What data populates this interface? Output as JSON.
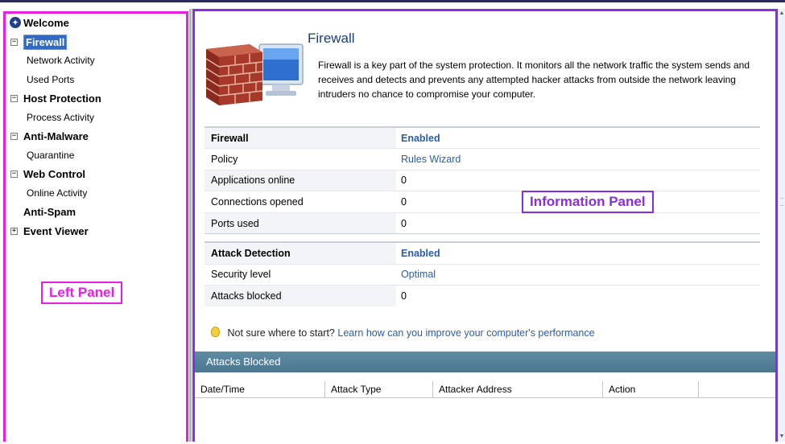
{
  "left_panel": {
    "annotation": "Left Panel",
    "tree": [
      {
        "label": "Welcome",
        "level": "top",
        "icon": "welcome-icon"
      },
      {
        "label": "Firewall",
        "level": "top",
        "expander": "⊟",
        "selected": true
      },
      {
        "label": "Network Activity",
        "level": "sub"
      },
      {
        "label": "Used Ports",
        "level": "sub"
      },
      {
        "label": "Host Protection",
        "level": "top",
        "expander": "⊟"
      },
      {
        "label": "Process Activity",
        "level": "sub"
      },
      {
        "label": "Anti-Malware",
        "level": "top",
        "expander": "⊟"
      },
      {
        "label": "Quarantine",
        "level": "sub"
      },
      {
        "label": "Web Control",
        "level": "top",
        "expander": "⊟"
      },
      {
        "label": "Online Activity",
        "level": "sub"
      },
      {
        "label": "Anti-Spam",
        "level": "top"
      },
      {
        "label": "Event Viewer",
        "level": "top",
        "expander": "⊞"
      }
    ]
  },
  "info_panel": {
    "annotation": "Information Panel",
    "title": "Firewall",
    "description": "Firewall is a key part of the system protection. It monitors all the network traffic the system sends and receives and detects and prevents any attempted hacker attacks from outside the network leaving intruders no chance to compromise your computer.",
    "firewall_rows": [
      {
        "label": "Firewall",
        "value": "Enabled",
        "link": true,
        "header": true
      },
      {
        "label": "Policy",
        "value": "Rules Wizard",
        "link": true
      },
      {
        "label": "Applications online",
        "value": "0"
      },
      {
        "label": "Connections opened",
        "value": "0"
      },
      {
        "label": "Ports used",
        "value": "0"
      }
    ],
    "attack_rows": [
      {
        "label": "Attack Detection",
        "value": "Enabled",
        "link": true,
        "header": true
      },
      {
        "label": "Security level",
        "value": "Optimal",
        "link": true
      },
      {
        "label": "Attacks blocked",
        "value": "0"
      }
    ],
    "tip": {
      "text": "Not sure where to start?",
      "link": "Learn how can you improve your computer's performance"
    },
    "attacks_blocked": {
      "title": "Attacks Blocked",
      "columns": [
        "Date/Time",
        "Attack Type",
        "Attacker Address",
        "Action"
      ]
    }
  },
  "colors": {
    "left_annotation": "#e61ee6",
    "info_annotation": "#8a2ce0",
    "link": "#2a5ca8",
    "title": "#1a3f7c",
    "bar": "#4a7690"
  }
}
